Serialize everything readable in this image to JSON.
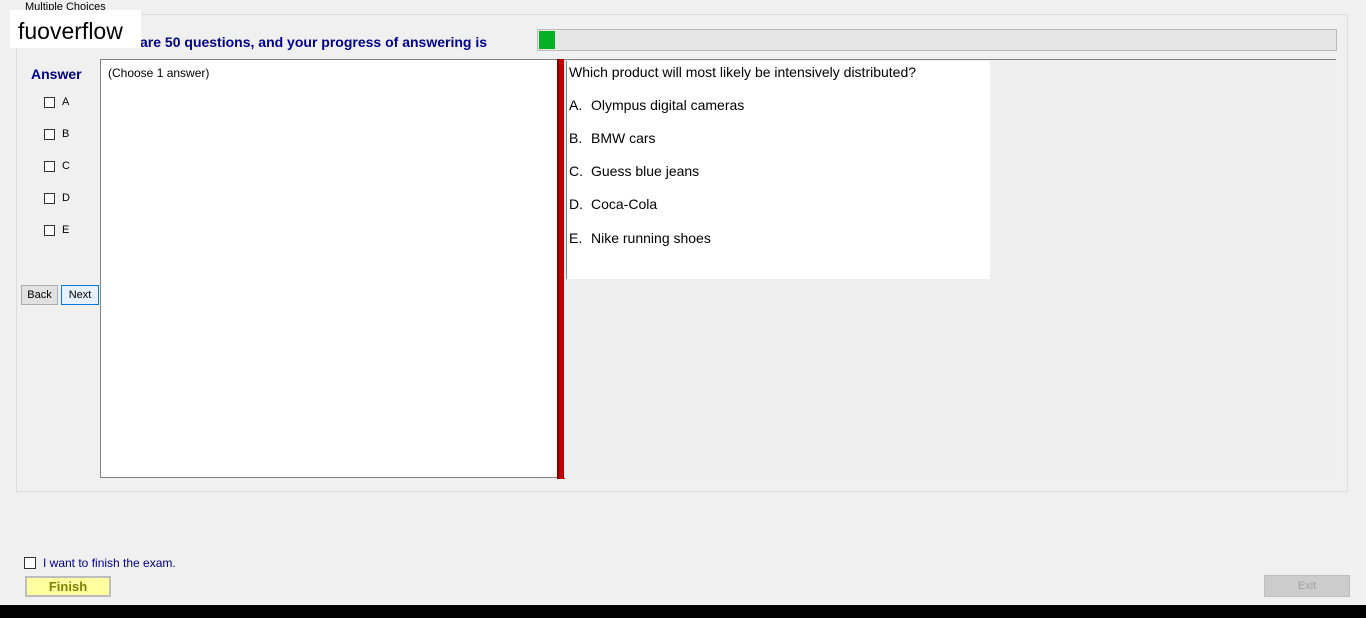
{
  "window": {
    "group_label": "Multiple Choices",
    "watermark": "fuoverflow"
  },
  "progress": {
    "text": "There are 50 questions, and your progress of answering is",
    "fraction": 0.02,
    "fill_color": "#06b025"
  },
  "answer": {
    "title": "Answer",
    "options": [
      "A",
      "B",
      "C",
      "D",
      "E"
    ]
  },
  "nav": {
    "back_label": "Back",
    "next_label": "Next"
  },
  "answer_panel": {
    "note": "(Choose 1 answer)"
  },
  "question": {
    "text": "Which product will most likely be intensively distributed?",
    "options": [
      {
        "letter": "A.",
        "text": "Olympus digital cameras"
      },
      {
        "letter": "B.",
        "text": "BMW cars"
      },
      {
        "letter": "C.",
        "text": "Guess blue jeans"
      },
      {
        "letter": "D.",
        "text": "Coca-Cola"
      },
      {
        "letter": "E.",
        "text": "Nike running shoes"
      }
    ]
  },
  "footer": {
    "finish_check_label": "I want to finish the exam.",
    "finish_label": "Finish",
    "exit_label": "Exit"
  },
  "colors": {
    "accent_text": "#00008b",
    "splitter": "#c00000",
    "finish_bg": "#ffff9f"
  }
}
